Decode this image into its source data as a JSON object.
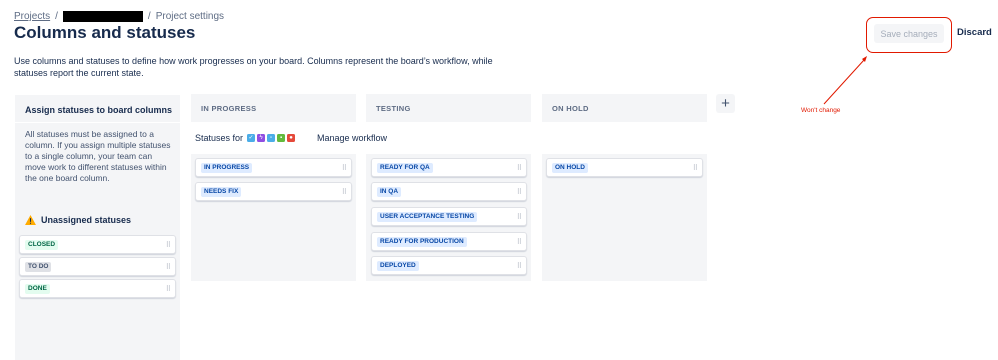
{
  "breadcrumb": {
    "projects": "Projects",
    "separator": "/",
    "current": "Project settings"
  },
  "page": {
    "title": "Columns and statuses",
    "description": "Use columns and statuses to define how work progresses on your board. Columns represent the board’s workflow, while statuses report the current state."
  },
  "actions": {
    "save": "Save changes",
    "discard": "Discard"
  },
  "annotation": {
    "text": "Won't change",
    "color": "#E11900"
  },
  "sidebar": {
    "title": "Assign statuses to board columns",
    "body": "All statuses must be assigned to a column. If you assign multiple statuses to a single column, your team can move work to different statuses within the one board column.",
    "unassigned_title": "Unassigned statuses",
    "statuses": [
      "CLOSED",
      "TO DO",
      "DONE"
    ]
  },
  "toolbar": {
    "statuses_for": "Statuses for",
    "manage_workflow": "Manage workflow",
    "issue_type_icons": [
      "task-icon",
      "epic-icon",
      "subtask-icon",
      "story-icon",
      "bug-icon"
    ]
  },
  "columns": [
    {
      "name": "IN PROGRESS",
      "statuses": [
        "IN PROGRESS",
        "NEEDS FIX"
      ]
    },
    {
      "name": "TESTING",
      "statuses": [
        "READY FOR QA",
        "IN QA",
        "USER ACCEPTANCE TESTING",
        "READY FOR PRODUCTION",
        "DEPLOYED"
      ]
    },
    {
      "name": "ON HOLD",
      "statuses": [
        "ON HOLD"
      ]
    }
  ],
  "colors": {
    "column_bg": "#F4F5F7",
    "text": "#172B4D",
    "done_lozenge": "#E3FCEF",
    "todo_lozenge": "#DFE1E6",
    "inprogress_lozenge": "#DEEBFF",
    "highlight": "#E11900"
  }
}
